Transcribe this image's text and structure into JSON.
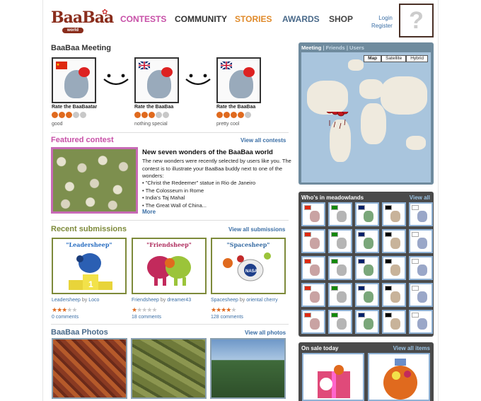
{
  "header": {
    "logo_text": "BaaBaa",
    "logo_sub": "world",
    "nav": [
      {
        "label": "CONTESTS",
        "color": "#c74fa7"
      },
      {
        "label": "COMMUNITY",
        "color": "#333333"
      },
      {
        "label": "STORIES",
        "color": "#e08a2a"
      },
      {
        "label": "AWARDS",
        "color": "#4a6a8a"
      },
      {
        "label": "SHOP",
        "color": "#444444"
      }
    ],
    "login": "Login",
    "register": "Register",
    "avatar_glyph": "?"
  },
  "meeting": {
    "title": "BaaBaa Meeting",
    "cards": [
      {
        "rate_label": "Rate the BaaBaatar",
        "rating": 3,
        "note": "good"
      },
      {
        "rate_label": "Rate the BaaBaa",
        "rating": 3,
        "note": "nothing special"
      },
      {
        "rate_label": "Rate the BaaBaa",
        "rating": 4,
        "note": "pretty cool"
      }
    ]
  },
  "featured": {
    "title": "Featured contest",
    "view_all": "View all contests",
    "headline": "New seven wonders of the BaaBaa world",
    "description": "The new wonders were recently selected by users like you. The contest is to illustrate your BaaBaa buddy next to one of the wonders:",
    "wonders": [
      "\"Christ the Redeemer\" statue in Rio de Janeiro",
      "The Colosseum in Rome",
      "India's Taj Mahal",
      "The Great Wall of China..."
    ],
    "more": "More"
  },
  "submissions": {
    "title": "Recent submissions",
    "view_all": "View all submissions",
    "items": [
      {
        "card_title": "\"Leadersheep\"",
        "name": "Leadersheep",
        "by": "by",
        "author": "Loco",
        "stars": 3,
        "comments": "0 comments"
      },
      {
        "card_title": "\"Friendsheep\"",
        "name": "Friendsheep",
        "by": "by",
        "author": "dreamer43",
        "stars": 1,
        "comments": "18 comments"
      },
      {
        "card_title": "\"Spacesheep\"",
        "name": "Spacesheep",
        "by": "by",
        "author": "oriental cherry",
        "stars": 4,
        "comments": "128 comments"
      }
    ]
  },
  "photos": {
    "title": "BaaBaa Photos",
    "view_all": "View all photos"
  },
  "map": {
    "tab_meeting": "Meeting",
    "sep": "|",
    "tab_friends": "Friends",
    "tab_users": "Users",
    "buttons": [
      "Map",
      "Satellite",
      "Hybrid"
    ],
    "active_button": "Map"
  },
  "who": {
    "title": "Who's in meadowlands",
    "view_all": "View all"
  },
  "sale": {
    "title": "On sale today",
    "view_all": "View all items"
  },
  "colors": {
    "meeting_title": "#333333",
    "featured_title": "#c74fa7",
    "submissions_title": "#7d8a3a",
    "photos_title": "#4a6a8a",
    "link": "#3a6ea5",
    "paw_on": "#e06a1e",
    "paw_off": "#c8c8c8"
  }
}
